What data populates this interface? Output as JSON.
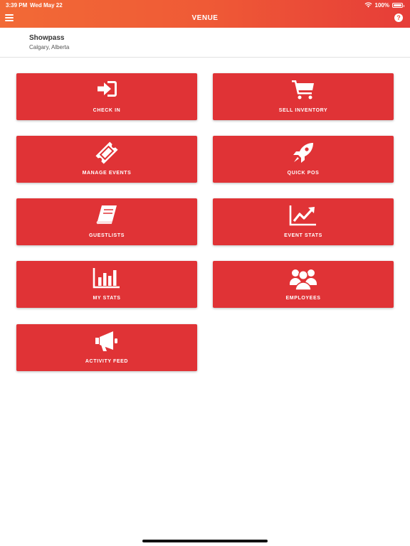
{
  "status_bar": {
    "time": "3:39 PM",
    "date": "Wed May 22",
    "battery": "100%"
  },
  "nav": {
    "title": "VENUE",
    "help_symbol": "?"
  },
  "venue": {
    "name": "Showpass",
    "location": "Calgary, Alberta"
  },
  "tiles": [
    {
      "label": "CHECK IN",
      "icon": "sign-in-icon"
    },
    {
      "label": "SELL INVENTORY",
      "icon": "shopping-cart-icon"
    },
    {
      "label": "MANAGE EVENTS",
      "icon": "ticket-icon"
    },
    {
      "label": "QUICK POS",
      "icon": "rocket-icon"
    },
    {
      "label": "GUESTLISTS",
      "icon": "book-icon"
    },
    {
      "label": "EVENT STATS",
      "icon": "line-chart-icon"
    },
    {
      "label": "MY STATS",
      "icon": "bar-chart-icon"
    },
    {
      "label": "EMPLOYEES",
      "icon": "users-icon"
    },
    {
      "label": "ACTIVITY FEED",
      "icon": "bullhorn-icon"
    }
  ],
  "colors": {
    "header_start": "#f26a36",
    "header_end": "#e63d38",
    "tile": "#e03336"
  }
}
